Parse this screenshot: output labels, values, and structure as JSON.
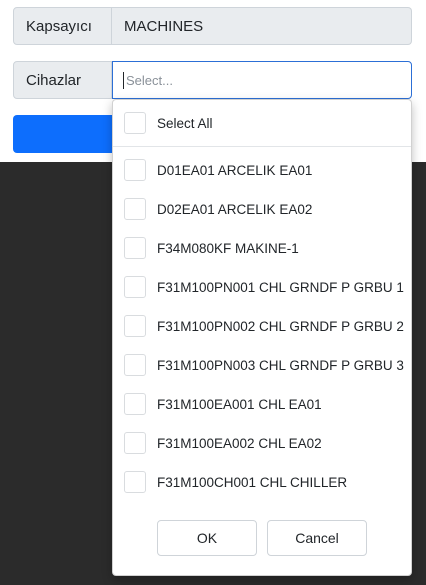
{
  "form": {
    "container_label": "Kapsayıcı",
    "container_value": "MACHINES",
    "devices_label": "Cihazlar",
    "devices_placeholder": "Select..."
  },
  "dropdown": {
    "select_all_label": "Select All",
    "items": [
      {
        "label": "D01EA01 ARCELIK EA01",
        "checked": false
      },
      {
        "label": "D02EA01 ARCELIK EA02",
        "checked": false
      },
      {
        "label": "F34M080KF MAKINE-1",
        "checked": false
      },
      {
        "label": "F31M100PN001 CHL GRNDF P GRBU 1",
        "checked": false
      },
      {
        "label": "F31M100PN002 CHL GRNDF P GRBU 2",
        "checked": false
      },
      {
        "label": "F31M100PN003 CHL GRNDF P GRBU 3",
        "checked": false
      },
      {
        "label": "F31M100EA001 CHL EA01",
        "checked": false
      },
      {
        "label": "F31M100EA002 CHL EA02",
        "checked": false
      },
      {
        "label": "F31M100CH001 CHL CHILLER",
        "checked": false
      }
    ],
    "ok_label": "OK",
    "cancel_label": "Cancel"
  },
  "colors": {
    "primary_button": "#0d6efd",
    "select_focus_border": "#2c6fd6",
    "backdrop": "#2b2b2b"
  }
}
